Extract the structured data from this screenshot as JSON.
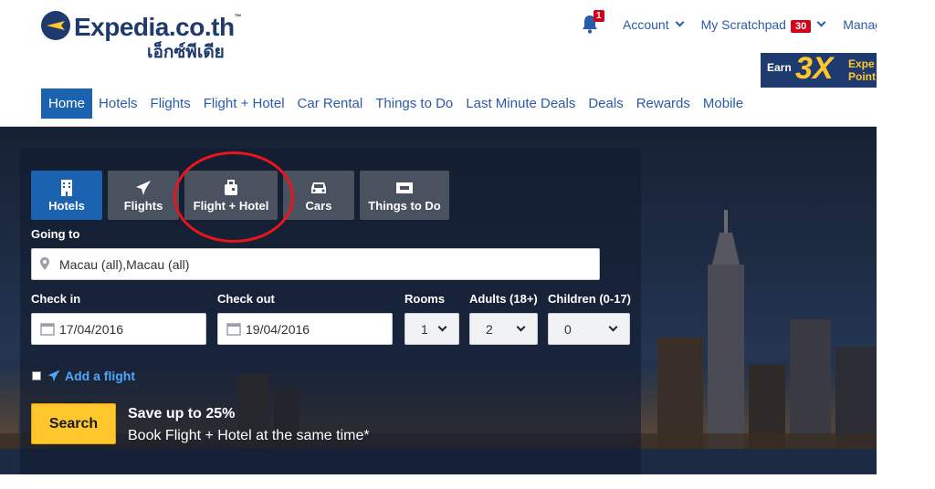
{
  "logo": {
    "name": "Expedia.co.th",
    "thai": "เอ็กซ์พีเดีย"
  },
  "topbar": {
    "notification_count": "1",
    "account_label": "Account",
    "scratchpad_label": "My Scratchpad",
    "scratchpad_count": "30",
    "manage_label": "Manage"
  },
  "promo": {
    "earn": "Earn",
    "multiplier": "3X",
    "text": "Expe Point"
  },
  "nav": {
    "items": [
      "Home",
      "Hotels",
      "Flights",
      "Flight + Hotel",
      "Car Rental",
      "Things to Do",
      "Last Minute Deals",
      "Deals",
      "Rewards",
      "Mobile"
    ],
    "active": "Home"
  },
  "search": {
    "tabs": [
      {
        "label": "Hotels",
        "icon": "hotel-icon"
      },
      {
        "label": "Flights",
        "icon": "plane-icon"
      },
      {
        "label": "Flight + Hotel",
        "icon": "luggage-icon"
      },
      {
        "label": "Cars",
        "icon": "car-icon"
      },
      {
        "label": "Things to Do",
        "icon": "ticket-icon"
      }
    ],
    "active_tab": "Hotels",
    "going_to_label": "Going to",
    "going_to_value": "Macau (all),Macau (all)",
    "check_in_label": "Check in",
    "check_in_value": "17/04/2016",
    "check_out_label": "Check out",
    "check_out_value": "19/04/2016",
    "rooms_label": "Rooms",
    "rooms_value": "1",
    "adults_label": "Adults (18+)",
    "adults_value": "2",
    "children_label": "Children (0-17)",
    "children_value": "0",
    "add_flight_label": "Add a flight",
    "search_button": "Search",
    "save_title": "Save up to 25%",
    "save_sub": "Book Flight + Hotel at the same time*"
  },
  "colors": {
    "brand_navy": "#1f3a6e",
    "primary_blue": "#1b62b1",
    "search_yellow": "#ffc72c",
    "badge_red": "#d0021b",
    "annotation_red": "#e8151b"
  }
}
